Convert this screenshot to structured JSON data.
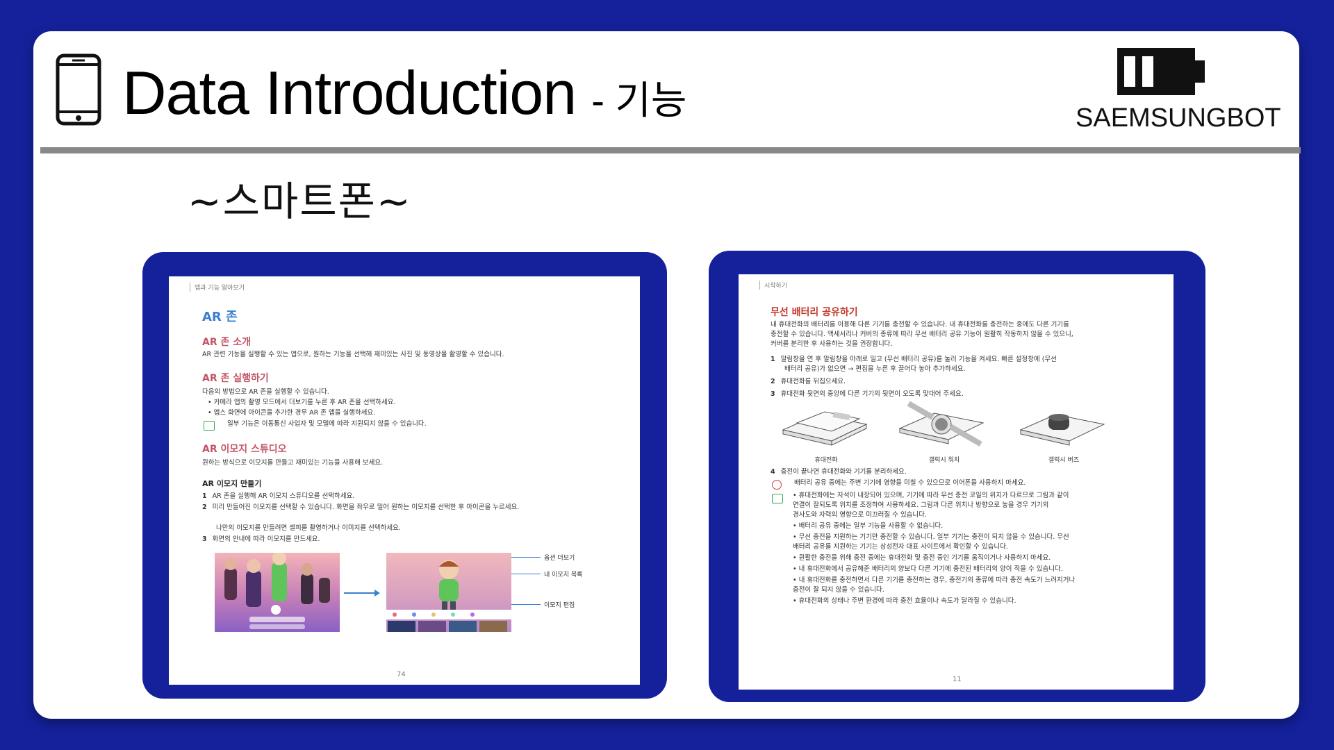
{
  "slide": {
    "title": "Data Introduction",
    "title_suffix": "- 기능",
    "brand": "SAEMSUNGBOT",
    "subtitle": "~스마트폰~"
  },
  "left_page": {
    "header": "앱과 기능 알아보기",
    "title": "AR 존",
    "sec1_heading": "AR 존 소개",
    "sec1_text": "AR 관련 기능을 실행할 수 있는 앱으로, 원하는 기능을 선택해 재미있는 사진 및 동영상을 촬영할 수 있습니다.",
    "sec2_heading": "AR 존 실행하기",
    "sec2_intro": "다음의 방법으로 AR 존을 실행할 수 있습니다.",
    "sec2_bullets": [
      "• 카메라 앱의 촬영 모드에서 더보기를 누른 후 AR 존을 선택하세요.",
      "• 앱스 화면에 아이콘을 추가한 경우 AR 존 앱을 실행하세요."
    ],
    "sec2_note": "일부 기능은 이동통신 사업자 및 모델에 따라 지원되지 않을 수 있습니다.",
    "sec3_heading": "AR 이모지 스튜디오",
    "sec3_text": "원하는 방식으로 이모지를 만들고 재미있는 기능을 사용해 보세요.",
    "sub_heading": "AR 이모지 만들기",
    "steps": [
      {
        "num": "1",
        "text": "AR 존을 실행해 AR 이모지 스튜디오를 선택하세요."
      },
      {
        "num": "2",
        "text": "미리 만들어진 이모지를 선택할 수 있습니다. 화면을 좌우로 밀어 원하는 이모지를 선택한 후 아이콘을 누르세요."
      },
      {
        "num": "",
        "text": "나만의 이모지를 만들려면 셀피를 촬영하거나 이미지를 선택하세요."
      },
      {
        "num": "3",
        "text": "화면의 안내에 따라 이모지를 만드세요."
      }
    ],
    "callouts": [
      "옵션 더보기",
      "내 이모지 목록",
      "이모지 편집"
    ],
    "page_number": "74"
  },
  "right_page": {
    "header": "시작하기",
    "title": "무선 배터리 공유하기",
    "intro": [
      "내 휴대전화의 배터리를 이용해 다른 기기를 충전할 수 있습니다. 내 휴대전화를 충전하는 중에도 다른 기기를",
      "충전할 수 있습니다. 액세서리나 커버의 종류에 따라 무선 배터리 공유 기능이 원활히 작동하지 않을 수 있으니,",
      "커버를 분리한 후 사용하는 것을 권장합니다."
    ],
    "steps": [
      {
        "num": "1",
        "text": "알림창을 연 후 알림창을 아래로 밀고 (무선 배터리 공유)를 눌러 기능을 켜세요. 빠른 설정창에 (무선"
      },
      {
        "num": "",
        "text": "배터리 공유)가 없으면 → 편집을 누른 후 끌어다 놓아 추가하세요."
      },
      {
        "num": "2",
        "text": "휴대전화를 뒤집으세요."
      },
      {
        "num": "3",
        "text": "휴대전화 뒷면의 중앙에 다른 기기의 뒷면이 오도록 맞대어 주세요."
      }
    ],
    "device_captions": [
      "휴대전화",
      "갤럭시 워치",
      "갤럭시 버즈"
    ],
    "step4": {
      "num": "4",
      "text": "충전이 끝나면 휴대전화와 기기를 분리하세요."
    },
    "warning": "배터리 공유 중에는 주변 기기에 영향을 미칠 수 있으므로 이어폰을 사용하지 마세요.",
    "notes": [
      "• 휴대전화에는 자석이 내장되어 있으며, 기기에 따라 무선 충전 코일의 위치가 다르므로 그림과 같이",
      "  연결이 잘되도록 위치를 조정하여 사용하세요. 그림과 다른 위치나 방향으로 놓을 경우 기기의",
      "  경사도와 자력의 영향으로 미끄러질 수 있습니다.",
      "• 배터리 공유 중에는 일부 기능을 사용할 수 없습니다.",
      "• 무선 충전을 지원하는 기기만 충전할 수 있습니다. 일부 기기는 충전이 되지 않을 수 있습니다. 무선",
      "  배터리 공유를 지원하는 기기는 삼성전자 대표 사이트에서 확인할 수 있습니다.",
      "• 원활한 충전을 위해 충전 중에는 휴대전화 및 충전 중인 기기를 움직이거나 사용하지 마세요.",
      "• 내 휴대전화에서 공유해준 배터리의 양보다 다른 기기에 충전된 배터리의 양이 적을 수 있습니다.",
      "• 내 휴대전화를 충전하면서 다른 기기를 충전하는 경우, 충전기의 종류에 따라 충전 속도가 느려지거나",
      "  충전이 잘 되지 않을 수 있습니다.",
      "• 휴대전화의 상태나 주변 환경에 따라 충전 효율이나 속도가 달라질 수 있습니다."
    ],
    "page_number": "11"
  }
}
